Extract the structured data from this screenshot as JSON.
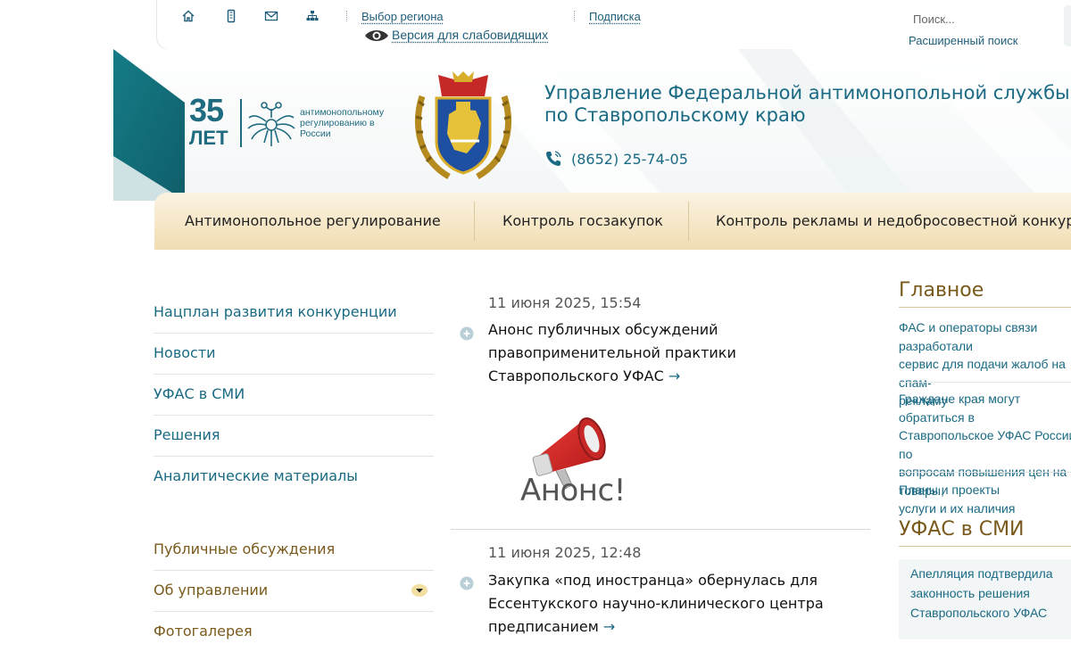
{
  "topbar": {
    "icons": [
      "home-icon",
      "mobile-icon",
      "mail-icon",
      "sitemap-icon"
    ],
    "region_label": "Выбор региона",
    "subscribe_label": "Подписка",
    "accessibility_label": "Версия для слабовидящих",
    "search_placeholder": "Поиск...",
    "advanced_search_label": "Расширенный поиск"
  },
  "header": {
    "anniversary_number": "35",
    "anniversary_word": "ЛЕТ",
    "anniversary_caption": "антимонопольному регулированию в России",
    "org_title_line1": "Управление Федеральной антимонопольной службы",
    "org_title_line2": "по Ставропольскому краю",
    "phone": "(8652) 25-74-05"
  },
  "nav": {
    "items": [
      {
        "label": "Антимонопольное регулирование"
      },
      {
        "label": "Контроль госзакупок"
      },
      {
        "label": "Контроль рекламы и недобросовестной конкуренции"
      }
    ]
  },
  "left_menu": {
    "items": [
      {
        "label": "Нацплан развития конкуренции"
      },
      {
        "label": "Новости"
      },
      {
        "label": "УФАС в СМИ"
      },
      {
        "label": "Решения"
      },
      {
        "label": "Аналитические материалы"
      }
    ],
    "items2": [
      {
        "label": "Публичные обсуждения"
      },
      {
        "label": "Об управлении"
      },
      {
        "label": "Фотогалерея"
      }
    ]
  },
  "news": [
    {
      "date": "11 июня 2025, 15:54",
      "title": "Анонс публичных обсуждений правоприменительной практики Ставропольского УФАС",
      "arrow": "→",
      "image_text": "Анонс!"
    },
    {
      "date": "11 июня 2025, 12:48",
      "title": "Закупка «под иностранца» обернулась для Ессентукского научно-клинического центра предписанием",
      "arrow": "→"
    }
  ],
  "right": {
    "main_heading": "Главное",
    "main_links": [
      {
        "text": "ФАС и операторы связи разработали\nсервис для подачи жалоб на спам-\nрекламу"
      },
      {
        "text": "Граждане края могут обратиться в\nСтавропольское УФАС России по\nвопросам повышения цен на товары,\nуслуги и их наличия"
      },
      {
        "text": "Планы и проекты"
      }
    ],
    "smi_heading": "УФАС в СМИ",
    "smi_link": "Апелляция подтвердила\nзаконность решения\nСтавропольского УФАС"
  },
  "colors": {
    "teal": "#1a6a84",
    "brown_heading": "#7a5a1c",
    "nav_gold": "#f1ddb2"
  }
}
